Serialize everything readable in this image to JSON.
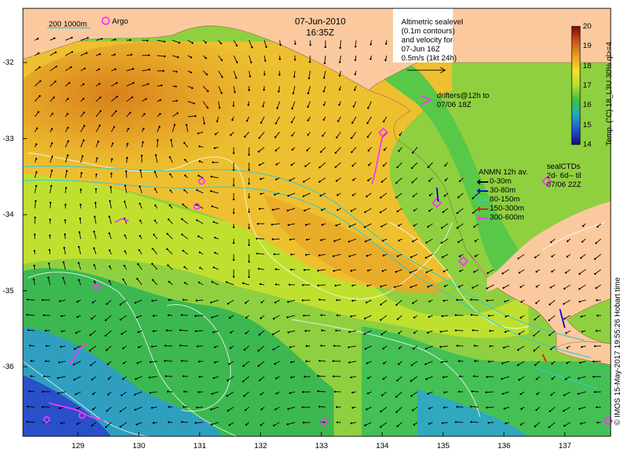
{
  "header": {
    "date": "07-Jun-2010",
    "time": "16:35Z"
  },
  "scale_legend": {
    "label": "200  1000m",
    "argo_label": "Argo"
  },
  "sealevel_note": {
    "lines": [
      "Altimetric sealevel",
      "(0.1m contours)",
      "and velocity for",
      "07-Jun 16Z",
      "0.5m/s (1kt 24h)"
    ]
  },
  "drifters_note": {
    "lines": [
      "drifters@12h to",
      "07/06 18Z"
    ]
  },
  "anmn_legend": {
    "title": "ANMN 12h av.",
    "items": [
      {
        "label": "0-30m",
        "color": "#000000"
      },
      {
        "label": "30-80m",
        "color": "#0000dd"
      },
      {
        "label": "80-150m",
        "color": "#33cccc"
      },
      {
        "label": "150-300m",
        "color": "#cc2222"
      },
      {
        "label": "300-600m",
        "color": "#ff33ff"
      }
    ]
  },
  "sealctd_legend": {
    "lines": [
      "sealCTDs",
      "2d- 6d-- til",
      "07/06 22Z"
    ]
  },
  "colorbar": {
    "title": "Temp. (°C) 18_L3U 30% ql>=4",
    "ticks": [
      "20",
      "19",
      "18",
      "17",
      "16",
      "15",
      "14"
    ],
    "colors": [
      "#7a0a0a",
      "#c8501a",
      "#e8a020",
      "#f2e030",
      "#b8e030",
      "#40c040",
      "#20a8c0",
      "#2050d0",
      "#10107a"
    ]
  },
  "axes": {
    "x_ticks": [
      "129",
      "130",
      "131",
      "132",
      "133",
      "134",
      "135",
      "136",
      "137"
    ],
    "y_ticks": [
      "-32",
      "-33",
      "-34",
      "-35",
      "-36"
    ]
  },
  "copyright": "© IMOS 15-May-2017 19:55:26 Hobart time",
  "colors": {
    "land": "#fbc99e",
    "sst_warm": "#e8a020",
    "sst_mid": "#c8e030",
    "sst_cool": "#40c050",
    "sst_cold": "#2a70d8",
    "contour": "#ffffff",
    "isobath": "#33cccc",
    "marker": "#ff33ff"
  }
}
